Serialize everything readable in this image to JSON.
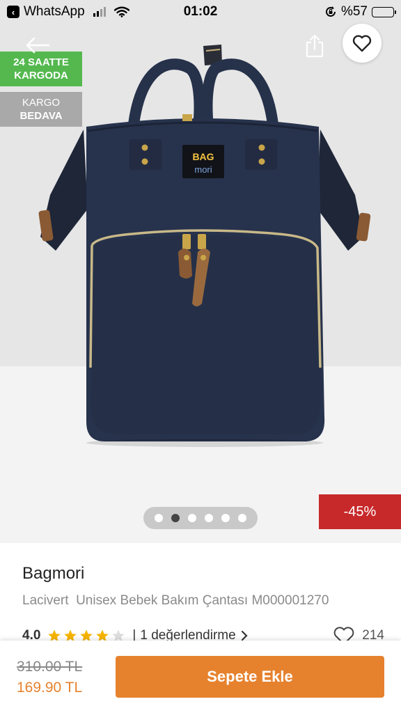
{
  "status_bar": {
    "back_app": "WhatsApp",
    "time": "01:02",
    "battery": "%57"
  },
  "gallery": {
    "badge_fast": [
      "24 SAATTE",
      "KARGODA"
    ],
    "badge_free": [
      "KARGO",
      "BEDAVA"
    ],
    "discount": "-45%",
    "logo_text": [
      "BAG",
      "mori"
    ],
    "page_count": 6,
    "active_page": 2
  },
  "product": {
    "brand": "Bagmori",
    "name": "Lacivert  Unisex Bebek Bakım Çantası M000001270",
    "rating": "4.0",
    "stars_filled": 4,
    "stars_total": 5,
    "review_separator": "|",
    "review_text": "1 değerlendirme",
    "likes": "214"
  },
  "purchase": {
    "old_price": "310.00 TL",
    "new_price": "169.90 TL",
    "cart_label": "Sepete Ekle"
  },
  "colors": {
    "accent": "#e6822e",
    "discount": "#c7292a",
    "fast_badge": "#54b84f",
    "free_badge": "#a9a9a9",
    "star": "#f5b301"
  },
  "icons": {
    "back": "arrow-left-icon",
    "share": "share-icon",
    "favorite": "heart-icon",
    "review_more": "chevron-right-icon",
    "likes": "heart-outline-icon"
  }
}
